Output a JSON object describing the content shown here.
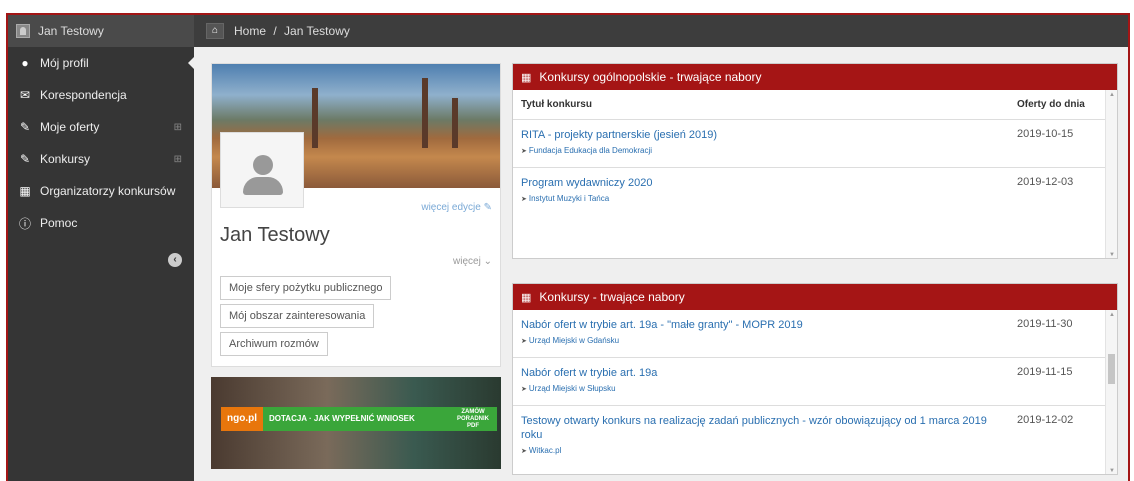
{
  "sidebar": {
    "user_name": "Jan Testowy",
    "items": [
      {
        "label": "Mój profil",
        "icon": "user-icon",
        "active": true
      },
      {
        "label": "Korespondencja",
        "icon": "envelope-icon"
      },
      {
        "label": "Moje oferty",
        "icon": "edit-icon",
        "expandable": true
      },
      {
        "label": "Konkursy",
        "icon": "edit-icon",
        "expandable": true
      },
      {
        "label": "Organizatorzy konkursów",
        "icon": "building-icon"
      },
      {
        "label": "Pomoc",
        "icon": "info-icon"
      }
    ]
  },
  "breadcrumb": {
    "home": "Home",
    "separator": "/",
    "current": "Jan Testowy"
  },
  "profile": {
    "edit_link": "więcej edycje",
    "name": "Jan Testowy",
    "more": "więcej",
    "buttons": [
      "Moje sfery pożytku publicznego",
      "Mój obszar zainteresowania",
      "Archiwum rozmów"
    ]
  },
  "promo": {
    "logo": "ngo.pl",
    "text_a": "DOTACJA",
    "text_b": "JAK WYPEŁNIĆ WNIOSEK",
    "order_text": "ZAMÓW PORADNIK PDF"
  },
  "panel1": {
    "title": "Konkursy ogólnopolskie - trwające nabory",
    "col_title": "Tytuł konkursu",
    "col_date": "Oferty do dnia",
    "rows": [
      {
        "title": "RITA - projekty partnerskie (jesień 2019)",
        "org": "Fundacja Edukacja dla Demokracji",
        "date": "2019-10-15"
      },
      {
        "title": "Program wydawniczy 2020",
        "org": "Instytut Muzyki i Tańca",
        "date": "2019-12-03"
      }
    ]
  },
  "panel2": {
    "title": "Konkursy - trwające nabory",
    "rows": [
      {
        "title": "Nabór ofert w trybie art. 19a - \"małe granty\" - MOPR 2019",
        "org": "Urząd Miejski w Gdańsku",
        "date": "2019-11-30"
      },
      {
        "title": "Nabór ofert w trybie art. 19a",
        "org": "Urząd Miejski w Słupsku",
        "date": "2019-11-15"
      },
      {
        "title": "Testowy otwarty konkurs na realizację zadań publicznych - wzór obowiązujący od 1 marca 2019 roku",
        "org": "Witkac.pl",
        "date": "2019-12-02"
      }
    ]
  }
}
